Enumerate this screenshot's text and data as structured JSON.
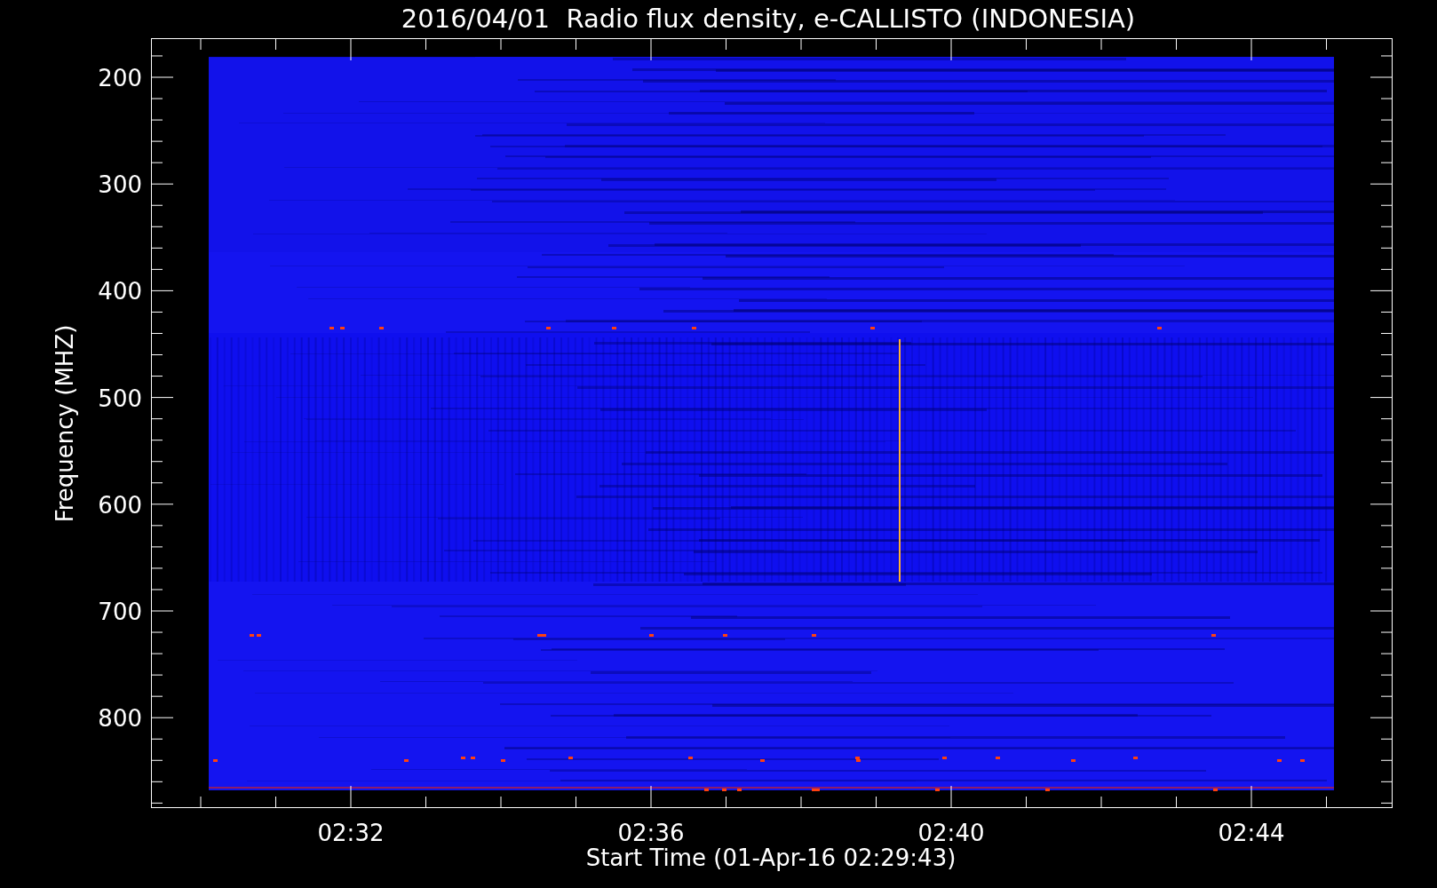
{
  "title": "2016/04/01  Radio flux density, e-CALLISTO (INDONESIA)",
  "y_axis": {
    "label": "Frequency (MHZ)",
    "ticks": [
      "200",
      "300",
      "400",
      "500",
      "600",
      "700",
      "800"
    ]
  },
  "x_axis": {
    "label": "Start Time (01-Apr-16 02:29:43)",
    "ticks": [
      "02:32",
      "02:36",
      "02:40",
      "02:44"
    ]
  }
}
